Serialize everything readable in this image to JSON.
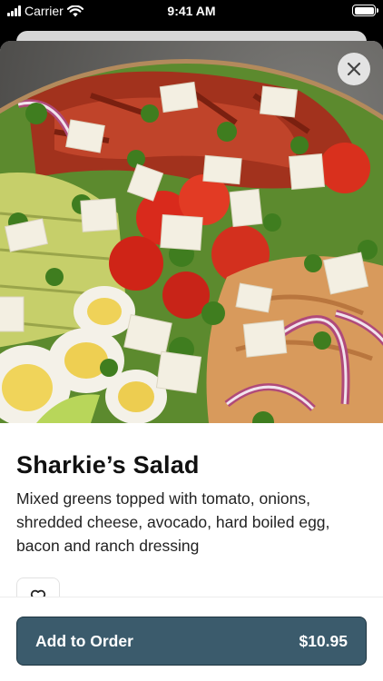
{
  "status_bar": {
    "carrier": "Carrier",
    "time": "9:41 AM"
  },
  "item": {
    "name": "Sharkie’s Salad",
    "description": "Mixed greens topped with tomato, onions, shredded cheese, avocado, hard boiled egg, bacon and ranch dressing",
    "image_icon": "salad-photo"
  },
  "actions": {
    "close_icon": "close-icon",
    "favorite_icon": "heart-icon",
    "add_label": "Add to Order",
    "price": "$10.95"
  },
  "colors": {
    "primary_button": "#3b5b6c",
    "text": "#111111"
  }
}
